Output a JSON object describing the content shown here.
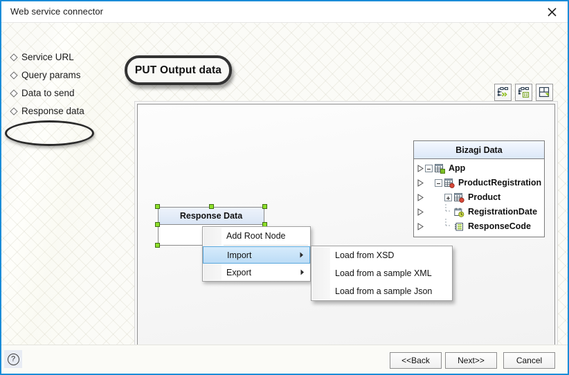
{
  "window": {
    "title": "Web service connector",
    "close_icon": "close-icon",
    "accent_border": "#1a8cd8"
  },
  "annotations": {
    "callout_label": "PUT Output data",
    "highlight_target": "Response data"
  },
  "sidebar": {
    "items": [
      {
        "label": "Service URL",
        "bullet": "diamond-bullet-icon",
        "selected": false
      },
      {
        "label": "Query params",
        "bullet": "diamond-bullet-icon",
        "selected": false
      },
      {
        "label": "Data to send",
        "bullet": "diamond-bullet-icon",
        "selected": false
      },
      {
        "label": "Response data",
        "bullet": "diamond-bullet-icon",
        "selected": true
      }
    ]
  },
  "toolbar": {
    "buttons": [
      {
        "name": "expand-all-button",
        "icon": "tree-expand-icon"
      },
      {
        "name": "node-properties-button",
        "icon": "tree-properties-icon"
      },
      {
        "name": "auto-layout-button",
        "icon": "layout-arrange-icon"
      }
    ]
  },
  "diagram": {
    "node": {
      "title": "Response Data",
      "selected": true,
      "handle_color": "#8ee02a"
    }
  },
  "tree_panel": {
    "title": "Bizagi Data",
    "rows": [
      {
        "label": "App",
        "indent": 0,
        "expander": "minus",
        "icon": "entity-green-icon",
        "drag": "drag-arrow-icon"
      },
      {
        "label": "ProductRegistration",
        "indent": 1,
        "expander": "minus",
        "icon": "entity-red-icon",
        "drag": "drag-arrow-icon"
      },
      {
        "label": "Product",
        "indent": 2,
        "expander": "plus",
        "icon": "entity-red-icon",
        "drag": "drag-arrow-icon"
      },
      {
        "label": "RegistrationDate",
        "indent": 2,
        "expander": "none",
        "icon": "date-attribute-icon",
        "drag": "drag-arrow-icon"
      },
      {
        "label": "ResponseCode",
        "indent": 2,
        "expander": "none",
        "icon": "list-attribute-icon",
        "drag": "drag-arrow-icon"
      }
    ]
  },
  "context_menu": {
    "items": [
      {
        "label": "Add Root Node",
        "has_submenu": false,
        "selected": false
      },
      {
        "label": "Import",
        "has_submenu": true,
        "selected": true
      },
      {
        "label": "Export",
        "has_submenu": true,
        "selected": false
      }
    ],
    "highlight_color": "#bcdcf6"
  },
  "submenu": {
    "items": [
      {
        "label": "Load from XSD"
      },
      {
        "label": "Load from a sample XML"
      },
      {
        "label": "Load from a sample Json"
      }
    ]
  },
  "footer": {
    "help_label": "?",
    "back_label": "<<Back",
    "next_label": "Next>>",
    "cancel_label": "Cancel"
  }
}
